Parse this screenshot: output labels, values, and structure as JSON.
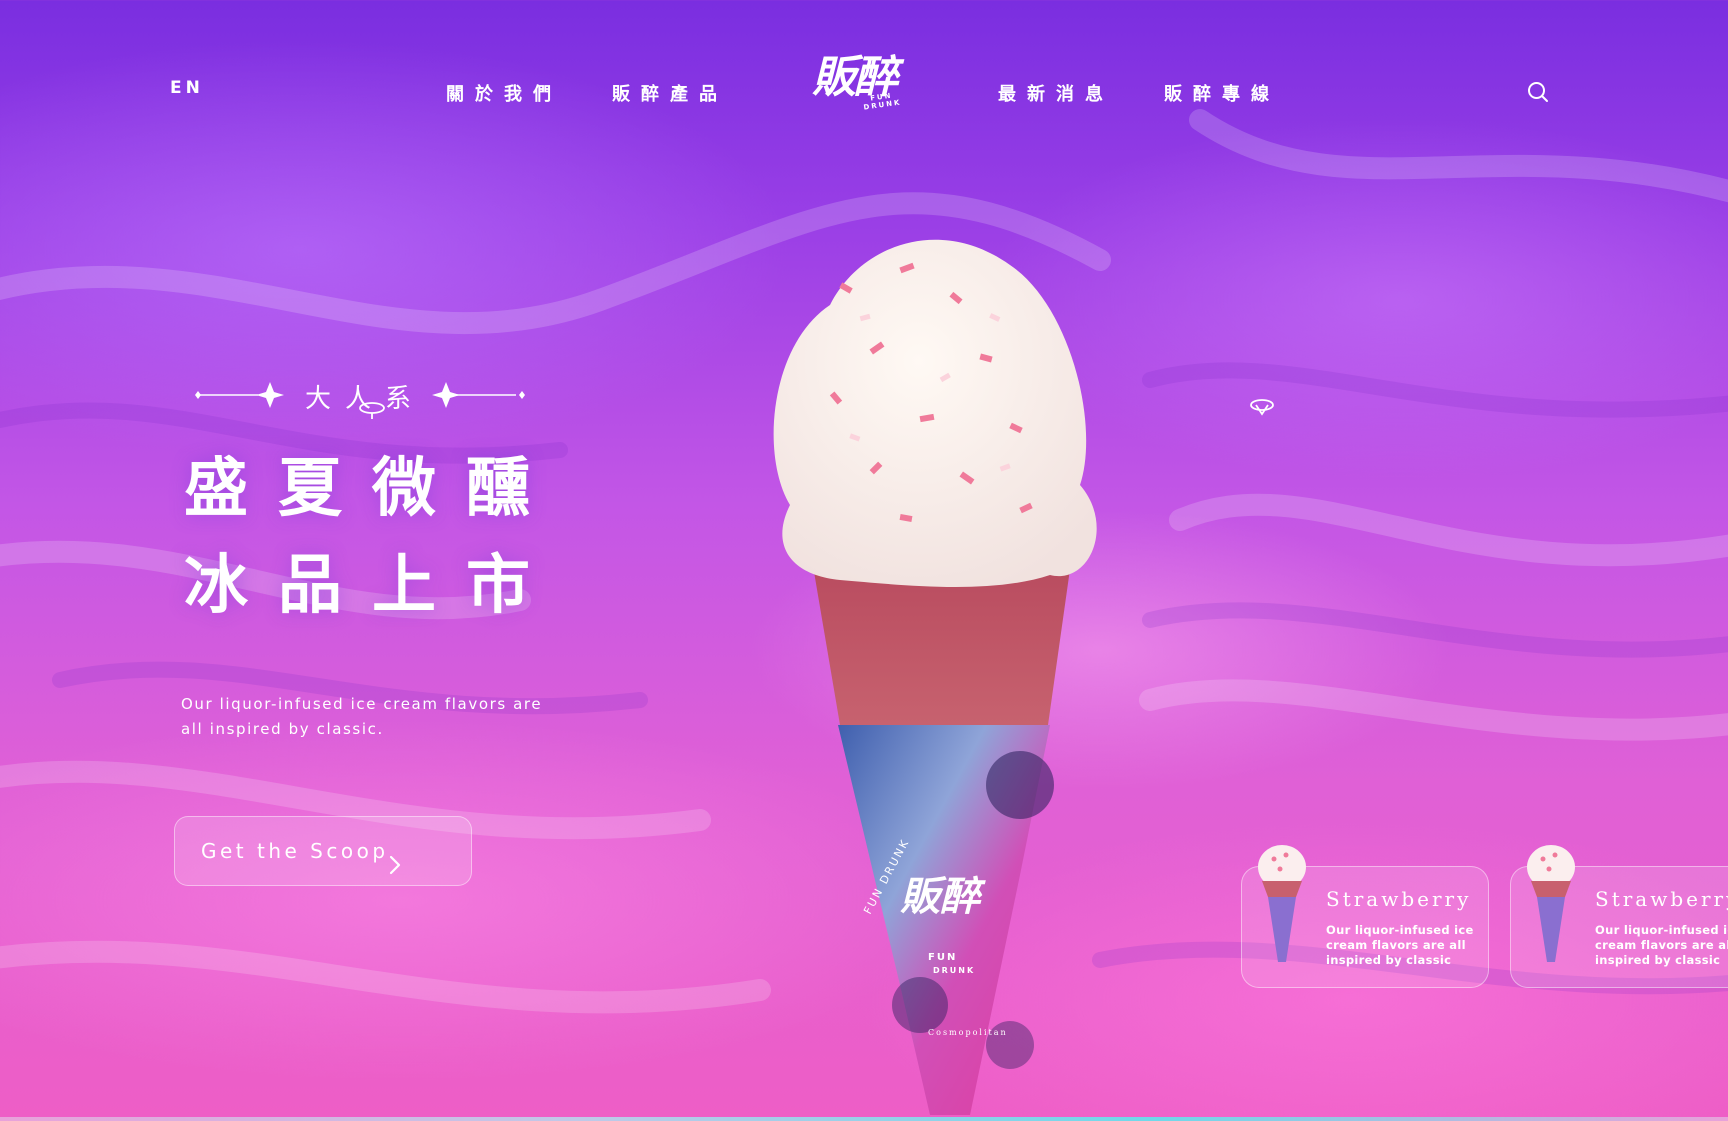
{
  "header": {
    "lang": "EN",
    "nav": [
      "關於我們",
      "販醉產品",
      "最新消息",
      "販醉專線"
    ],
    "logo": {
      "main": "販醉",
      "sub_line1": "FUN",
      "sub_line2": "DRUNK"
    },
    "search_icon": "search-icon"
  },
  "hero": {
    "tagline": "大人系",
    "headline_line1": "盛夏微醺",
    "headline_line2": "冰品上市",
    "description": "Our liquor-infused ice cream flavors are all inspired by classic.",
    "cta_label": "Get the Scoop",
    "cta_icon": "chevron-right-icon"
  },
  "cone_wrap": {
    "brand_arc": "FUN DRUNK",
    "brand_main": "販醉",
    "brand_sub": "FUN DRUNK",
    "flavor": "Cosmopolitan"
  },
  "products": [
    {
      "title": "Strawberry",
      "description": "Our liquor-infused ice cream flavors are all inspired by classic"
    },
    {
      "title": "Strawberry",
      "description": "Our liquor-infused ice cream flavors are all inspired by classic"
    }
  ],
  "colors": {
    "bg_top": "#7a2ee0",
    "bg_bottom": "#ee5ec6",
    "text": "#ffffff"
  }
}
